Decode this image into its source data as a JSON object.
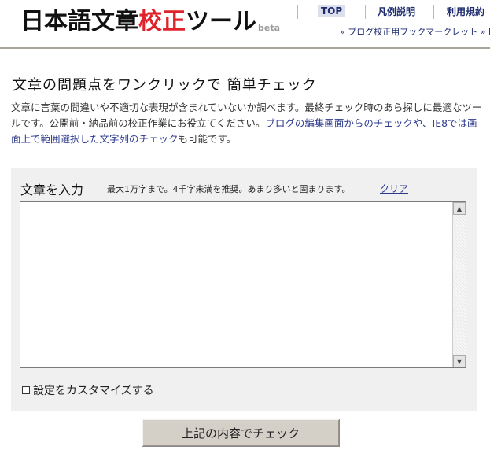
{
  "header": {
    "logo": {
      "part1": "日本語文章",
      "accent": "校正",
      "part2": "ツール",
      "beta": "beta"
    },
    "nav": [
      {
        "label": "TOP"
      },
      {
        "label": "凡例説明"
      },
      {
        "label": "利用規約"
      }
    ],
    "sub_link": "» ブログ校正用ブックマークレット » IE"
  },
  "main": {
    "headline": "文章の問題点をワンクリックで 簡単チェック",
    "intro": {
      "p1": "文章に言葉の間違いや不適切な表現が含まれていないか調べます。最終チェック時のあら探しに最適なツールです。公開前・納品前の校正作業にお役立てください。",
      "p2": "ブログの編集画面からのチェックや、IE8では画面上で範囲選択した文字列のチェック",
      "p3": "も可能です。"
    },
    "input": {
      "title": "文章を入力",
      "note": "最大1万字まで。4千字未満を推奨。あまり多いと固まります。",
      "clear": "クリア",
      "value": "",
      "placeholder": ""
    },
    "customize_label": "設定をカスタマイズする",
    "submit_label": "上記の内容でチェック"
  },
  "colors": {
    "accent": "#e0232a",
    "link": "#1d2b6e",
    "panel_bg": "#f0f0f0",
    "button_bg": "#d4d0c8",
    "rule": "#a8a49a"
  }
}
